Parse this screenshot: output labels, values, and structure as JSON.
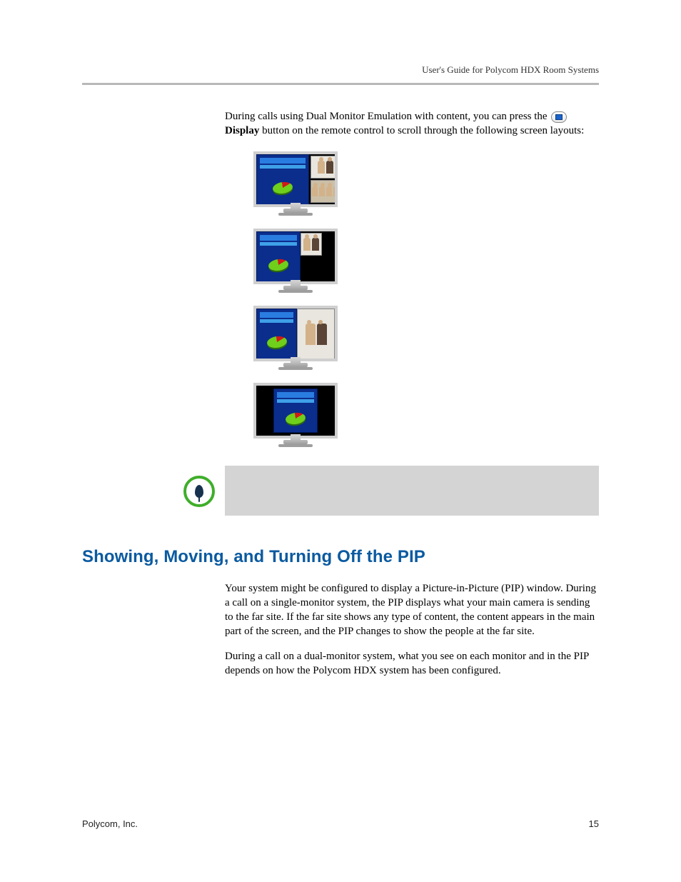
{
  "header": {
    "running_head": "User's Guide for Polycom HDX Room Systems"
  },
  "intro": {
    "line1": "During calls using Dual Monitor Emulation with content, you can press the ",
    "display_label": "Display",
    "line2": " button on the remote control to scroll through the following screen layouts:"
  },
  "section": {
    "heading": "Showing, Moving, and Turning Off the PIP",
    "para1": "Your system might be configured to display a Picture-in-Picture (PIP) window. During a call on a single-monitor system, the PIP displays what your main camera is sending to the far site. If the far site shows any type of content, the content appears in the main part of the screen, and the PIP changes to show the people at the far site.",
    "para2": "During a call on a dual-monitor system, what you see on each monitor and in the PIP depends on how the Polycom HDX system has been configured."
  },
  "figures": {
    "layout1_desc": "Content large on left, two stacked people tiles on right",
    "layout2_desc": "Content on left, one people tile upper middle, rest black",
    "layout3_desc": "Content left half, people right half",
    "layout4_desc": "Content centered with black side bars"
  },
  "footer": {
    "company": "Polycom, Inc.",
    "page": "15"
  }
}
